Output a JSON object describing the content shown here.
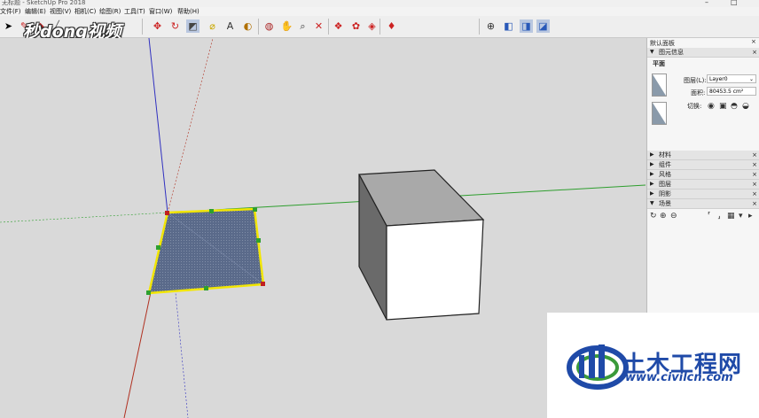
{
  "window": {
    "title": "无标题 - SketchUp Pro 2018",
    "controls": [
      "–",
      "□"
    ]
  },
  "menu": [
    "文件(F)",
    "编辑(E)",
    "视图(V)",
    "相机(C)",
    "绘图(R)",
    "工具(T)",
    "窗口(W)",
    "帮助(H)"
  ],
  "watermark_text": "秒dong视频",
  "toolbar": {
    "icons": [
      "select-icon",
      "eraser-icon",
      "paint-bucket-icon",
      "line-icon",
      "move-icon",
      "rotate-icon",
      "scale-icon",
      "tape-measure-icon",
      "text-icon",
      "protractor-icon",
      "orbit-icon",
      "pan-icon",
      "zoom-icon",
      "zoom-extents-icon",
      "warehouse-icon",
      "extension-icon",
      "components-icon",
      "ruby-icon",
      "axes-icon",
      "iso-view-icon",
      "front-view-icon",
      "right-view-icon"
    ]
  },
  "tray": {
    "title": "默认面板",
    "entity_info": {
      "header": "图元信息",
      "entity_type": "平面",
      "layer_label": "图层(L):",
      "layer_value": "Layer0",
      "area_label": "面积:",
      "area_value": "80453.5 cm²",
      "toggle_label": "切换:"
    },
    "panels": [
      {
        "label": "材料",
        "state": "collapsed"
      },
      {
        "label": "组件",
        "state": "collapsed"
      },
      {
        "label": "风格",
        "state": "collapsed"
      },
      {
        "label": "图层",
        "state": "collapsed"
      },
      {
        "label": "阴影",
        "state": "collapsed"
      },
      {
        "label": "场景",
        "state": "expanded"
      }
    ],
    "close_glyph": "×"
  },
  "logo": {
    "name": "土木工程网",
    "url": "www.civilcn.com"
  },
  "colors": {
    "viewport_bg": "#d9d9d9",
    "face_fill": "#5a6a8a",
    "selection_outline": "#f2e600",
    "axis_green": "#2e9e2e",
    "axis_red": "#b03020",
    "axis_blue": "#3030c0",
    "logo_blue": "#1f4aa8"
  }
}
